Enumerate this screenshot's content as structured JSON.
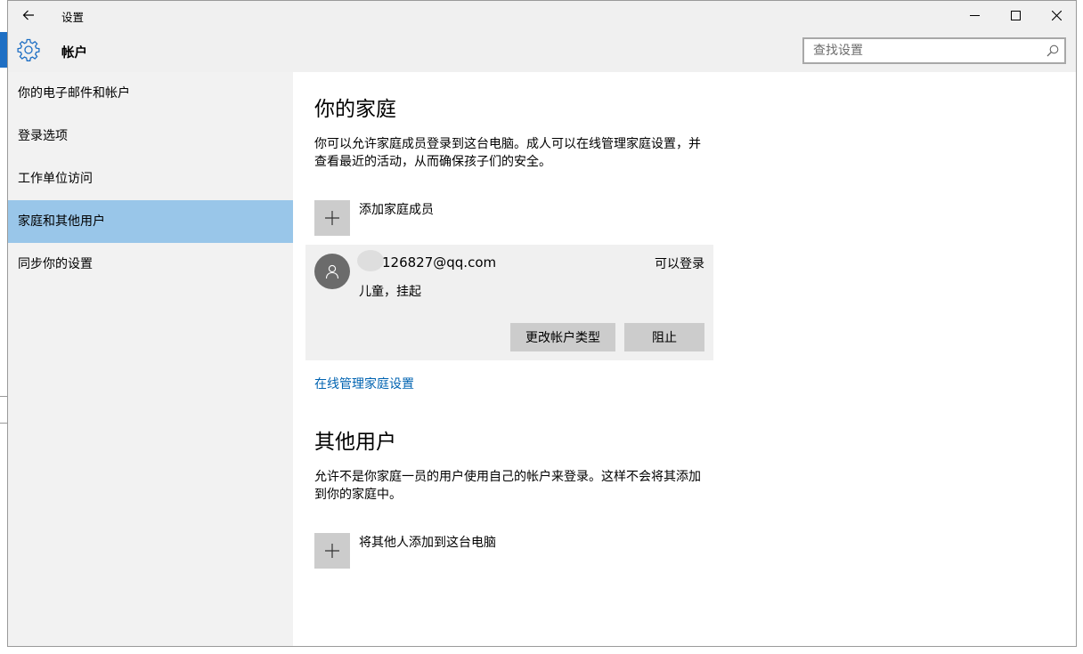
{
  "window": {
    "title": "设置"
  },
  "header": {
    "section": "帐户",
    "search_placeholder": "查找设置"
  },
  "sidebar": {
    "items": [
      {
        "label": "你的电子邮件和帐户",
        "active": false
      },
      {
        "label": "登录选项",
        "active": false
      },
      {
        "label": "工作单位访问",
        "active": false
      },
      {
        "label": "家庭和其他用户",
        "active": true
      },
      {
        "label": "同步你的设置",
        "active": false
      }
    ]
  },
  "family": {
    "title": "你的家庭",
    "description": "你可以允许家庭成员登录到这台电脑。成人可以在线管理家庭设置，并查看最近的活动，从而确保孩子们的安全。",
    "add_label": "添加家庭成员",
    "member": {
      "email": "126827@qq.com",
      "status": "可以登录",
      "role": "儿童，挂起",
      "change_type_label": "更改帐户类型",
      "block_label": "阻止"
    },
    "manage_link": "在线管理家庭设置"
  },
  "others": {
    "title": "其他用户",
    "description": "允许不是你家庭一员的用户使用自己的帐户来登录。这样不会将其添加到你的家庭中。",
    "add_label": "将其他人添加到这台电脑"
  },
  "colors": {
    "accent": "#0063b1",
    "sidebar_active": "#99c6e9",
    "chrome": "#f0f0f0"
  }
}
